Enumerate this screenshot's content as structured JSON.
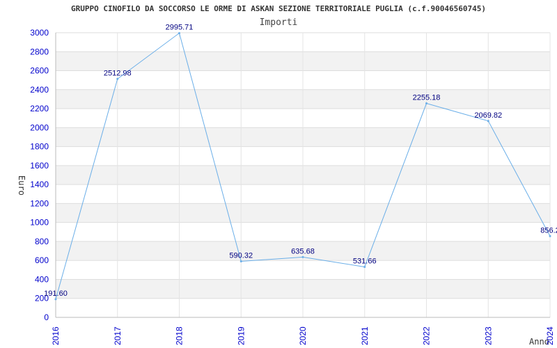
{
  "chart_data": {
    "type": "line",
    "title": "GRUPPO CINOFILO DA SOCCORSO LE ORME DI ASKAN SEZIONE TERRITORIALE PUGLIA (c.f.90046560745)",
    "subtitle": "Importi",
    "xlabel": "Anno",
    "ylabel": "Euro",
    "x": [
      "2016",
      "2017",
      "2018",
      "2019",
      "2020",
      "2021",
      "2022",
      "2023",
      "2024"
    ],
    "series": [
      {
        "values": [
          191.6,
          2512.98,
          2995.71,
          590.32,
          635.68,
          531.66,
          2255.18,
          2069.82,
          856.2
        ],
        "labels": [
          "191.60",
          "2512.98",
          "2995.71",
          "590.32",
          "635.68",
          "531.66",
          "2255.18",
          "2069.82",
          "856.2"
        ],
        "color": "#6aaee8"
      }
    ],
    "ylim": [
      0,
      3000
    ],
    "yticks": [
      "0",
      "200",
      "400",
      "600",
      "800",
      "1000",
      "1200",
      "1400",
      "1600",
      "1800",
      "2000",
      "2200",
      "2400",
      "2600",
      "2800",
      "3000"
    ],
    "grid": true,
    "band_color": "#f2f2f2"
  }
}
